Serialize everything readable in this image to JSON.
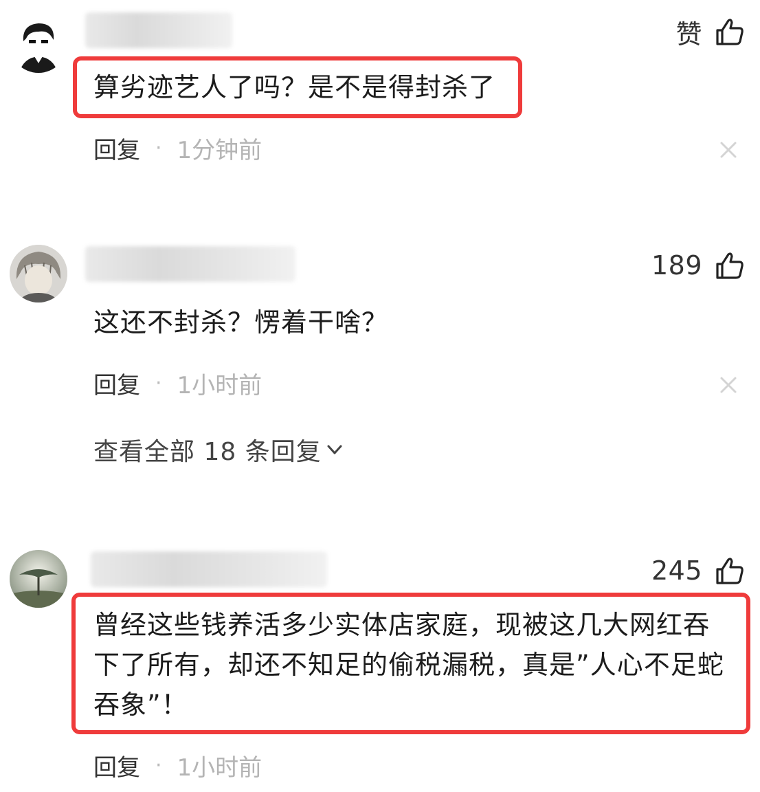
{
  "comments": [
    {
      "like_label": "赞",
      "text_lines": [
        "算劣迹艺人了吗？是不是得封杀了"
      ],
      "reply_label": "回复",
      "separator": "·",
      "time": "1分钟前"
    },
    {
      "like_label": "189",
      "text_lines": [
        "这还不封杀？愣着干啥？"
      ],
      "reply_label": "回复",
      "separator": "·",
      "time": "1小时前",
      "view_all_replies": "查看全部 18 条回复"
    },
    {
      "like_label": "245",
      "text_lines": [
        "曾经这些钱养活多少实体店家庭，现被这几大网红吞",
        "下了所有，却还不知足的偷税漏税，真是”人心不足蛇",
        "吞象”！"
      ],
      "reply_label": "回复",
      "separator": "·",
      "time": "1小时前"
    }
  ],
  "colors": {
    "highlight": "#ef3b3b",
    "time_text": "#b4b4b4",
    "body_text": "#1c1c1c"
  },
  "icons": [
    "thumbs-up-icon",
    "close-icon",
    "chevron-down-icon"
  ]
}
